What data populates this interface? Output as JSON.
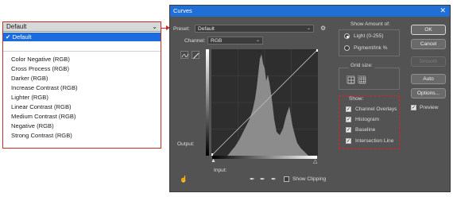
{
  "preset_dropdown": {
    "current": "Default",
    "items": [
      {
        "label": "Default",
        "selected": true
      },
      {
        "label": "Color Negative (RGB)"
      },
      {
        "label": "Cross Process (RGB)"
      },
      {
        "label": "Darker (RGB)"
      },
      {
        "label": "Increase Contrast (RGB)"
      },
      {
        "label": "Lighter (RGB)"
      },
      {
        "label": "Linear Contrast (RGB)"
      },
      {
        "label": "Medium Contrast (RGB)"
      },
      {
        "label": "Negative (RGB)"
      },
      {
        "label": "Strong Contrast (RGB)"
      }
    ]
  },
  "dialog": {
    "title": "Curves",
    "preset_label": "Preset:",
    "preset_value": "Default",
    "channel_label": "Channel:",
    "channel_value": "RGB",
    "output_label": "Output:",
    "input_label": "Input:",
    "show_clipping_label": "Show Clipping",
    "show_amount_title": "Show Amount of:",
    "light_label": "Light  (0-255)",
    "pigment_label": "Pigment/Ink %",
    "grid_size_title": "Grid size:",
    "show_title": "Show:",
    "show_options": [
      {
        "label": "Channel Overlays",
        "checked": true
      },
      {
        "label": "Histogram",
        "checked": true
      },
      {
        "label": "Baseline",
        "checked": true
      },
      {
        "label": "Intersection Line",
        "checked": true
      }
    ],
    "buttons": {
      "ok": "OK",
      "cancel": "Cancel",
      "smooth": "Smooth",
      "auto": "Auto",
      "options": "Options..."
    },
    "preview_label": "Preview",
    "preview_checked": true
  },
  "colors": {
    "titlebar": "#1f6fd6",
    "dialog_bg": "#535353",
    "highlight": "#e02020",
    "selected_item": "#1c6ce0"
  },
  "icons": [
    "gear-icon",
    "curve-point-icon",
    "pencil-icon",
    "grid-4-icon",
    "grid-10-icon",
    "on-image-adjust-icon",
    "black-eyedropper-icon",
    "gray-eyedropper-icon",
    "white-eyedropper-icon",
    "close-icon",
    "checkmark-icon"
  ]
}
